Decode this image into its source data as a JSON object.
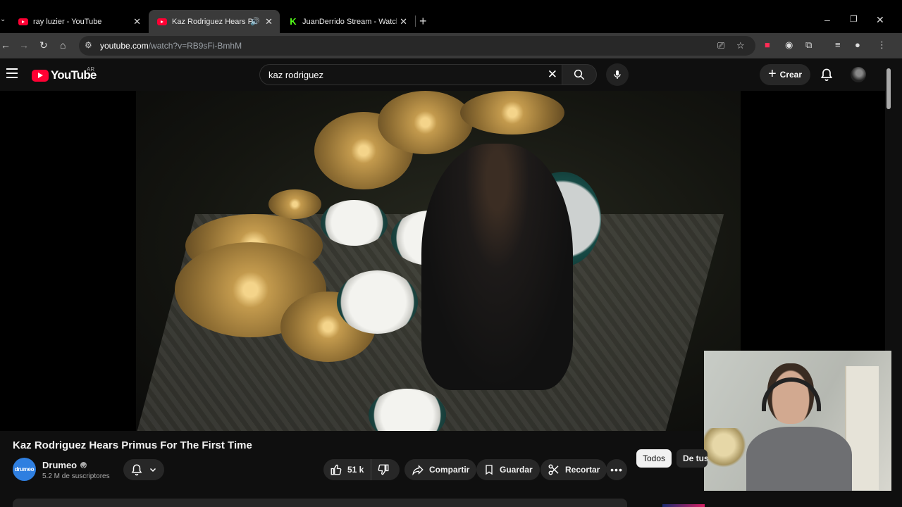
{
  "browser": {
    "tabs": [
      {
        "title": "ray luzier - YouTube",
        "favicon": "youtube-icon",
        "active": false
      },
      {
        "title": "Kaz Rodriguez Hears Primus For The First Time",
        "favicon": "youtube-icon",
        "active": true,
        "audio": true
      },
      {
        "title": "JuanDerrido Stream - Watch Live on Kick",
        "favicon": "kick-icon",
        "active": false
      }
    ],
    "url_host": "youtube.com",
    "url_path": "/watch?v=RB9sFi-BmhM"
  },
  "masthead": {
    "logo_text": "YouTube",
    "country_code": "AR",
    "search_query": "kaz rodriguez",
    "create_label": "Crear"
  },
  "video": {
    "title": "Kaz Rodriguez Hears Primus For The First Time",
    "channel_name": "Drumeo",
    "channel_avatar_text": "drumeo",
    "subscribers": "5.2 M de suscriptores",
    "likes": "51 k",
    "share_label": "Compartir",
    "save_label": "Guardar",
    "clip_label": "Recortar"
  },
  "chips": [
    "Todos",
    "De tus búsquedas"
  ],
  "colors": {
    "youtube_red": "#ff0033",
    "kick_green": "#53fc18",
    "drumeo_blue": "#2f7fe0",
    "background": "#0f0f0f"
  }
}
